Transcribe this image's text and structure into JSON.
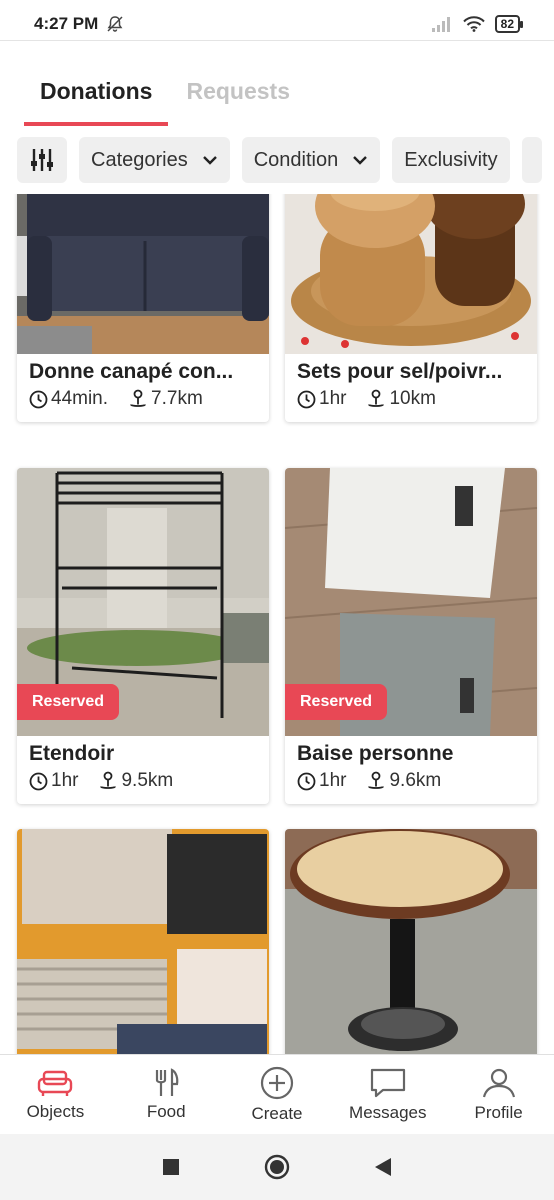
{
  "status_bar": {
    "time": "4:27 PM",
    "battery": "82"
  },
  "tabs": [
    {
      "label": "Donations",
      "active": true
    },
    {
      "label": "Requests",
      "active": false
    }
  ],
  "filters": {
    "icon": "sliders-icon",
    "chips": [
      {
        "label": "Categories",
        "has_dropdown": true
      },
      {
        "label": "Condition",
        "has_dropdown": true
      },
      {
        "label": "Exclusivity",
        "has_dropdown": false
      }
    ]
  },
  "listings": [
    {
      "title": "Donne canapé con...",
      "time": "44min.",
      "distance": "7.7km",
      "reserved": false,
      "image": "dark-sofa"
    },
    {
      "title": "Sets pour sel/poivr...",
      "time": "1hr",
      "distance": "10km",
      "reserved": false,
      "image": "wooden-salt-pepper-mills"
    },
    {
      "title": "Etendoir",
      "time": "1hr",
      "distance": "9.5km",
      "reserved": true,
      "badge": "Reserved",
      "image": "metal-drying-rack"
    },
    {
      "title": "Baise personne",
      "time": "1hr",
      "distance": "9.6km",
      "reserved": true,
      "badge": "Reserved",
      "image": "glass-bathroom-scales"
    },
    {
      "title": "",
      "time": "",
      "distance": "",
      "reserved": false,
      "image": "pile-of-clothes"
    },
    {
      "title": "",
      "time": "",
      "distance": "",
      "reserved": true,
      "badge": "",
      "image": "round-wooden-table"
    }
  ],
  "bottom_nav": [
    {
      "label": "Objects",
      "icon": "sofa-icon",
      "active": true
    },
    {
      "label": "Food",
      "icon": "fork-knife-icon",
      "active": false
    },
    {
      "label": "Create",
      "icon": "plus-circle-icon",
      "active": false
    },
    {
      "label": "Messages",
      "icon": "chat-bubble-icon",
      "active": false
    },
    {
      "label": "Profile",
      "icon": "person-icon",
      "active": false
    }
  ],
  "colors": {
    "accent": "#e84855",
    "chip_bg": "#efefef",
    "text": "#222222",
    "inactive_tab": "#c3c3c3"
  }
}
